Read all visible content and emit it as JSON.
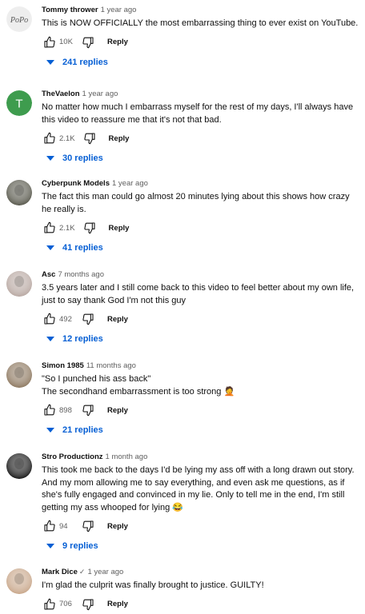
{
  "comments": [
    {
      "author": "Tommy thrower",
      "time": "1 year ago",
      "verified": false,
      "avatar": {
        "type": "logo",
        "text": "PoPo",
        "color": "#dcdcdc"
      },
      "lines": [
        "This is NOW OFFICIALLY the most embarrassing thing to ever exist on YouTube."
      ],
      "likes": "10K",
      "reply_label": "Reply",
      "replies_label": "241 replies"
    },
    {
      "author": "TheVaelon",
      "time": "1 year ago",
      "verified": false,
      "avatar": {
        "type": "letter",
        "text": "T",
        "color": "#3e9c4e"
      },
      "lines": [
        "No matter how much I embarrass myself for the rest of my days, I'll always have",
        "this video to reassure me that it's not that bad."
      ],
      "likes": "2.1K",
      "reply_label": "Reply",
      "replies_label": "30 replies"
    },
    {
      "author": "Cyberpunk Models",
      "time": "1 year ago",
      "verified": false,
      "avatar": {
        "type": "photo",
        "color": "#5a5a4e"
      },
      "lines": [
        "The fact this man could go almost 20 minutes lying about this shows how crazy",
        "he really is."
      ],
      "likes": "2.1K",
      "reply_label": "Reply",
      "replies_label": "41 replies"
    },
    {
      "author": "Asc",
      "time": "7 months ago",
      "verified": false,
      "avatar": {
        "type": "photo",
        "color": "#b9a9a3"
      },
      "lines": [
        "3.5 years later and I still come back to this video to feel better about my own life,",
        "just to say thank God I'm not this guy"
      ],
      "likes": "492",
      "reply_label": "Reply",
      "replies_label": "12 replies"
    },
    {
      "author": "Simon 1985",
      "time": "11 months ago",
      "verified": false,
      "avatar": {
        "type": "photo",
        "color": "#8f7a62"
      },
      "lines": [
        "\"So I punched his ass back\"",
        "The secondhand embarrassment is too strong 🤦"
      ],
      "likes": "898",
      "reply_label": "Reply",
      "replies_label": "21 replies"
    },
    {
      "author": "Stro Productionz",
      "time": "1 month ago",
      "verified": false,
      "avatar": {
        "type": "photo",
        "color": "#1a1a1a"
      },
      "lines": [
        "This took me back to the days I'd be lying my ass off with a long drawn out story.",
        "And my mom allowing me to say everything, and even ask me questions, as if",
        "she's fully engaged and convinced in my lie. Only to tell me in the end, I'm still",
        "getting my ass whooped for lying 😂"
      ],
      "likes": "94",
      "reply_label": "Reply",
      "replies_label": "9 replies"
    },
    {
      "author": "Mark Dice",
      "time": "1 year ago",
      "verified": true,
      "avatar": {
        "type": "photo",
        "color": "#c9a88c"
      },
      "lines": [
        "I'm glad the culprit was finally brought to justice.   GUILTY!"
      ],
      "likes": "706",
      "reply_label": "Reply",
      "replies_label": ""
    }
  ],
  "icons": {
    "like": "thumb-up-icon",
    "dislike": "thumb-down-icon",
    "expand": "triangle-down-icon",
    "verified": "checkmark-icon"
  },
  "colors": {
    "link": "#065fd4",
    "secondary_text": "#606060"
  }
}
